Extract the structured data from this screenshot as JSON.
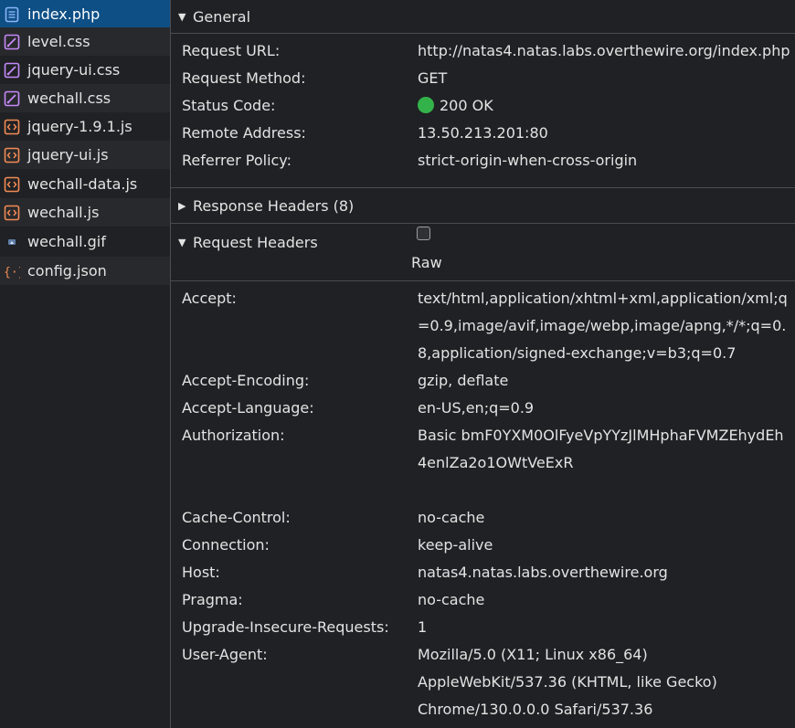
{
  "files": [
    {
      "name": "index.php",
      "icon": "document-icon",
      "selected": true
    },
    {
      "name": "level.css",
      "icon": "stylesheet-icon"
    },
    {
      "name": "jquery-ui.css",
      "icon": "stylesheet-icon"
    },
    {
      "name": "wechall.css",
      "icon": "stylesheet-icon"
    },
    {
      "name": "jquery-1.9.1.js",
      "icon": "script-icon"
    },
    {
      "name": "jquery-ui.js",
      "icon": "script-icon"
    },
    {
      "name": "wechall-data.js",
      "icon": "script-icon"
    },
    {
      "name": "wechall.js",
      "icon": "script-icon"
    },
    {
      "name": "wechall.gif",
      "icon": "image-icon"
    },
    {
      "name": "config.json",
      "icon": "json-icon"
    }
  ],
  "general": {
    "title": "General",
    "rows": [
      {
        "key": "Request URL:",
        "value": "http://natas4.natas.labs.overthewire.org/index.php"
      },
      {
        "key": "Request Method:",
        "value": "GET"
      },
      {
        "key": "Status Code:",
        "value": "200 OK"
      },
      {
        "key": "Remote Address:",
        "value": "13.50.213.201:80"
      },
      {
        "key": "Referrer Policy:",
        "value": "strict-origin-when-cross-origin"
      }
    ]
  },
  "response_headers": {
    "title": "Response Headers (8)"
  },
  "request_headers": {
    "title": "Request Headers",
    "raw_label": "Raw",
    "raw_checked": false,
    "rows": [
      {
        "key": "Accept:",
        "value": "text/html,application/xhtml+xml,application/xml;q=0.9,image/avif,image/webp,image/apng,*/*;q=0.8,application/signed-exchange;v=b3;q=0.7"
      },
      {
        "key": "Accept-Encoding:",
        "value": "gzip, deflate"
      },
      {
        "key": "Accept-Language:",
        "value": "en-US,en;q=0.9"
      },
      {
        "key": "Authorization:",
        "value": "Basic bmF0YXM0OlFyeVpYYzJlMHphaFVMZEhydEh4enlZa2o1OWtVeExR"
      },
      {
        "key": "Cache-Control:",
        "value": "no-cache"
      },
      {
        "key": "Connection:",
        "value": "keep-alive"
      },
      {
        "key": "Host:",
        "value": "natas4.natas.labs.overthewire.org"
      },
      {
        "key": "Pragma:",
        "value": "no-cache"
      },
      {
        "key": "Upgrade-Insecure-Requests:",
        "value": "1"
      },
      {
        "key": "User-Agent:",
        "value": "Mozilla/5.0 (X11; Linux x86_64) AppleWebKit/537.36 (KHTML, like Gecko) Chrome/130.0.0.0 Safari/537.36"
      }
    ]
  },
  "colors": {
    "selected_row": "#0e4f86",
    "status_ok": "#34b24a",
    "stylesheet_icon": "#c58af9",
    "script_icon": "#f28b54",
    "json_icon": "#f28b54",
    "document_icon": "#8ab4f8"
  }
}
